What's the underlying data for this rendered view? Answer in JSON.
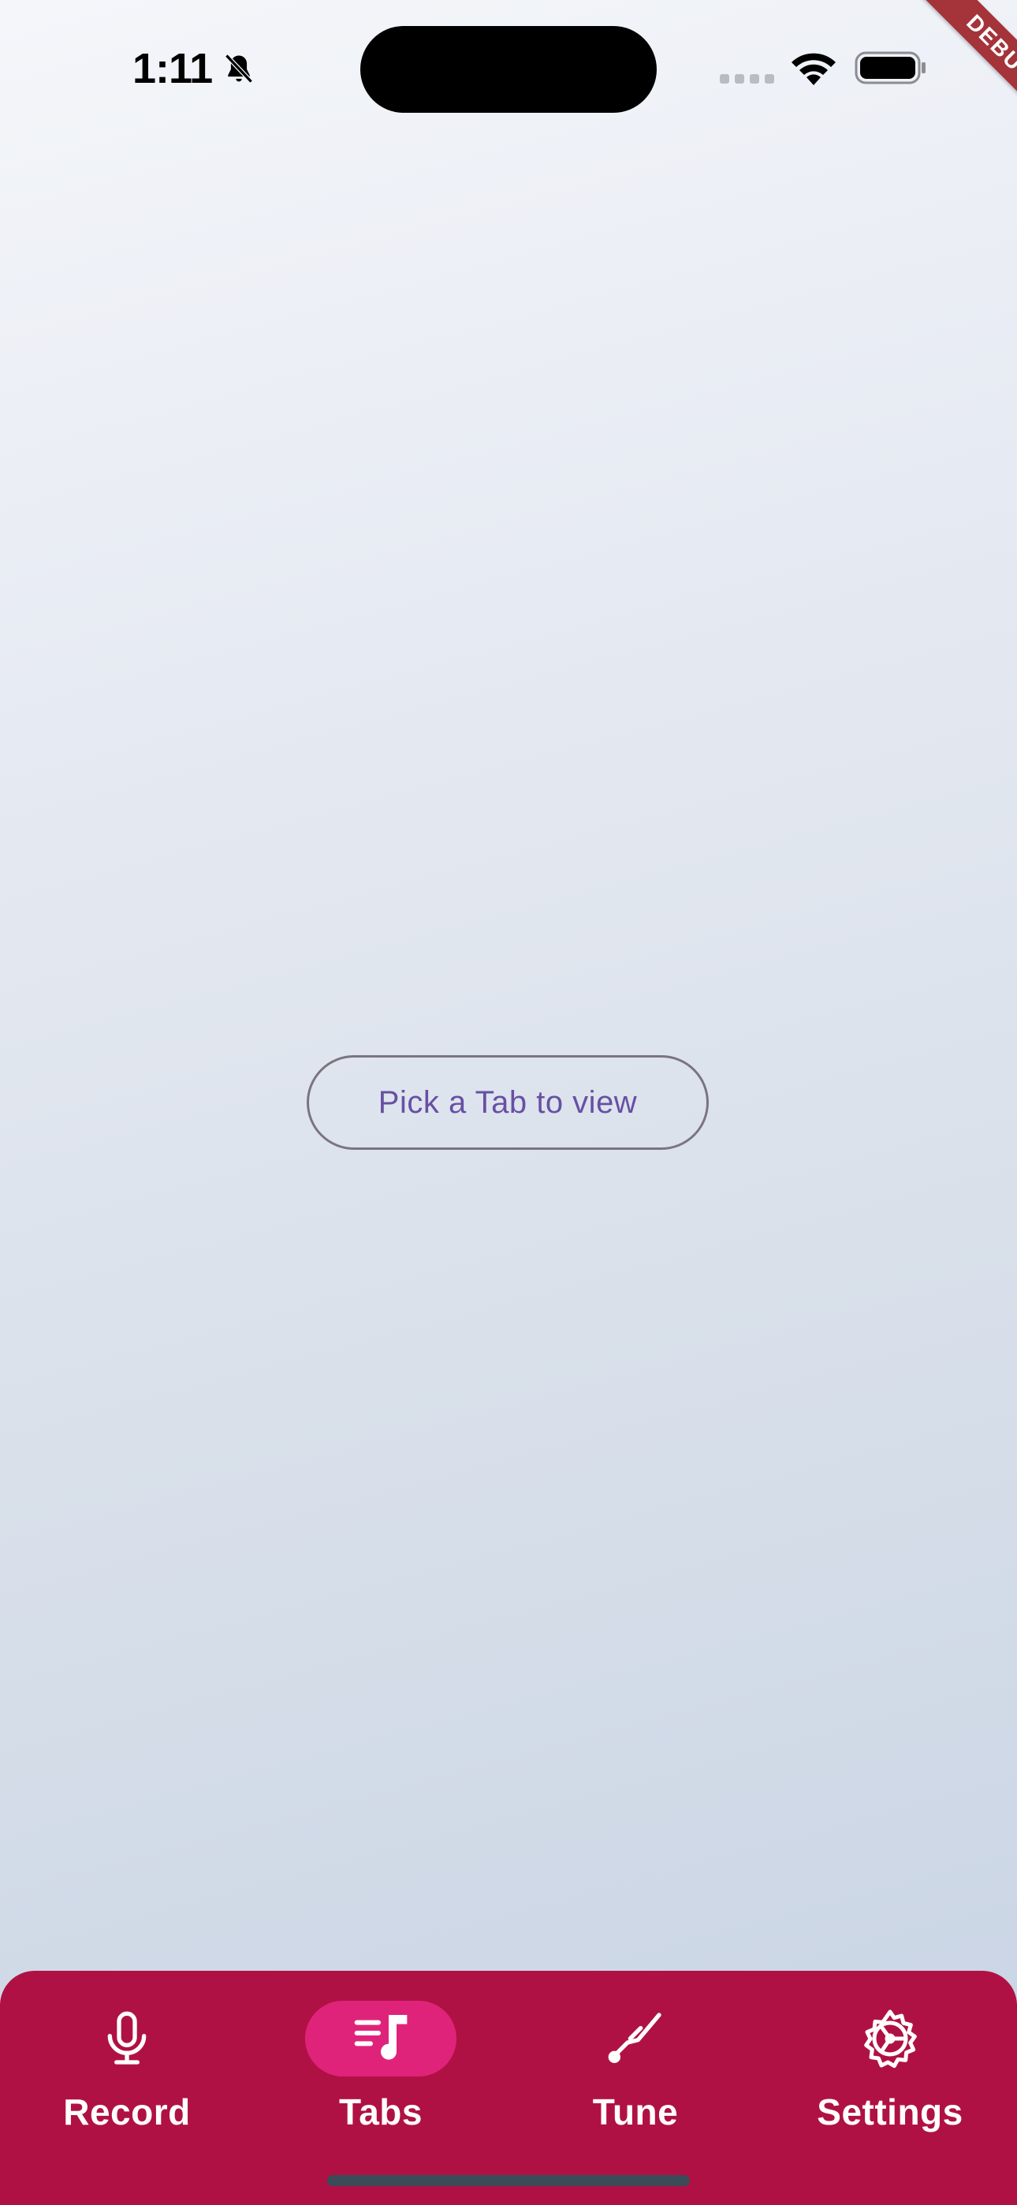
{
  "status_bar": {
    "time": "1:11",
    "silent_icon": "bell-slash-icon",
    "signal_icon": "cellular-signal-icon",
    "wifi_icon": "wifi-icon",
    "battery_icon": "battery-icon"
  },
  "debug_banner": {
    "label": "DEBUG",
    "color": "#a4343a"
  },
  "main": {
    "pick_tab_button_label": "Pick a Tab to view",
    "button_text_color": "#6750a4"
  },
  "bottom_nav": {
    "background_color": "#b01144",
    "active_indicator_color": "#e0237a",
    "items": [
      {
        "label": "Record",
        "icon": "microphone-icon",
        "active": false
      },
      {
        "label": "Tabs",
        "icon": "music-notes-list-icon",
        "active": true
      },
      {
        "label": "Tune",
        "icon": "tuning-fork-icon",
        "active": false
      },
      {
        "label": "Settings",
        "icon": "gear-icon",
        "active": false
      }
    ]
  }
}
